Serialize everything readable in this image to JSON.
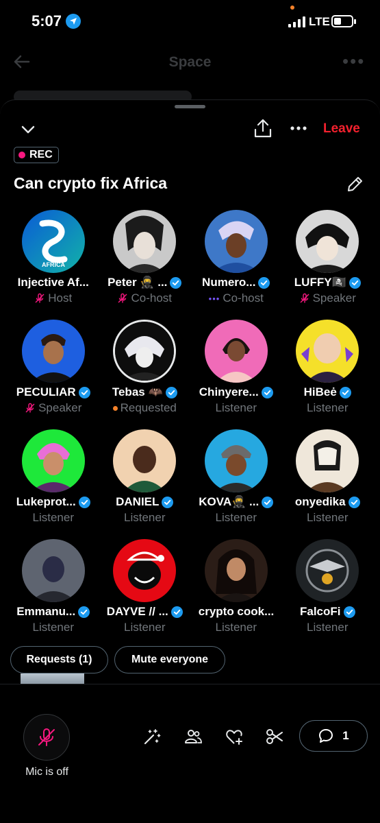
{
  "status_bar": {
    "time": "5:07",
    "network": "LTE"
  },
  "behind_header": {
    "title": "Space"
  },
  "sheet": {
    "leave_label": "Leave",
    "rec_label": "REC",
    "title": "Can crypto fix Africa"
  },
  "participants": [
    {
      "name": "Injective Af...",
      "role": "Host",
      "verified": false,
      "role_icon": "mic-off-icon"
    },
    {
      "name": "Peter 🥷 ...",
      "role": "Co-host",
      "verified": true,
      "role_icon": "mic-off-icon"
    },
    {
      "name": "Numero...",
      "role": "Co-host",
      "verified": true,
      "role_icon": "typing-dots-icon"
    },
    {
      "name": "LUFFY🏴‍☠️",
      "role": "Speaker",
      "verified": true,
      "role_icon": "mic-off-icon"
    },
    {
      "name": "PECULIAR",
      "role": "Speaker",
      "verified": true,
      "role_icon": "mic-off-icon"
    },
    {
      "name": "Tebas 🦇",
      "role": "Requested",
      "verified": true,
      "role_icon": "requested-dot-icon"
    },
    {
      "name": "Chinyere...",
      "role": "Listener",
      "verified": true,
      "role_icon": ""
    },
    {
      "name": "HiBeė",
      "role": "Listener",
      "verified": true,
      "role_icon": ""
    },
    {
      "name": "Lukeprot...",
      "role": "Listener",
      "verified": true,
      "role_icon": ""
    },
    {
      "name": "DANIEL",
      "role": "Listener",
      "verified": true,
      "role_icon": ""
    },
    {
      "name": "KOVA🥷 ...",
      "role": "Listener",
      "verified": true,
      "role_icon": ""
    },
    {
      "name": "onyedika",
      "role": "Listener",
      "verified": true,
      "role_icon": ""
    },
    {
      "name": "Emmanu...",
      "role": "Listener",
      "verified": true,
      "role_icon": ""
    },
    {
      "name": "DAYVE // ...",
      "role": "Listener",
      "verified": true,
      "role_icon": ""
    },
    {
      "name": "crypto cook...",
      "role": "Listener",
      "verified": false,
      "role_icon": ""
    },
    {
      "name": "FalcoFi",
      "role": "Listener",
      "verified": true,
      "role_icon": ""
    }
  ],
  "actions": {
    "requests_label": "Requests (1)",
    "mute_label": "Mute everyone"
  },
  "bottom_bar": {
    "mic_label": "Mic is off",
    "comment_count": "1"
  },
  "colors": {
    "accent_red": "#f4212e",
    "verified_blue": "#1d9bf0",
    "role_pink": "#f91880",
    "requested_orange": "#f5822a",
    "muted_text": "#71767b"
  }
}
